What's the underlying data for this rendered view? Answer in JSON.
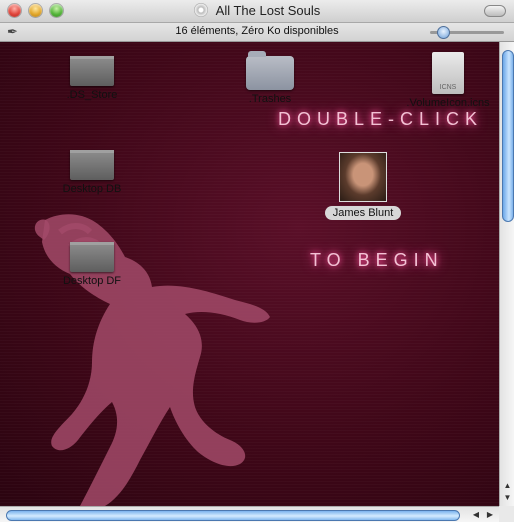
{
  "window": {
    "title": "All The Lost Souls",
    "status": "16 éléments, Zéro Ko disponibles"
  },
  "icons": [
    {
      "label": ".DS_Store",
      "kind": "file"
    },
    {
      "label": "Desktop DB",
      "kind": "file"
    },
    {
      "label": "Desktop DF",
      "kind": "file"
    },
    {
      "label": ".Trashes",
      "kind": "folder"
    },
    {
      "label": ".VolumeIcon.icns",
      "kind": "icns",
      "doc_text": "ICNS"
    }
  ],
  "feature": {
    "label": "James Blunt",
    "line1": "DOUBLE-CLICK",
    "line2": "TO BEGIN"
  },
  "colors": {
    "background": "#3f0718",
    "glow_text": "#f3c1d4",
    "accent_blue": "#6ba7e8"
  }
}
